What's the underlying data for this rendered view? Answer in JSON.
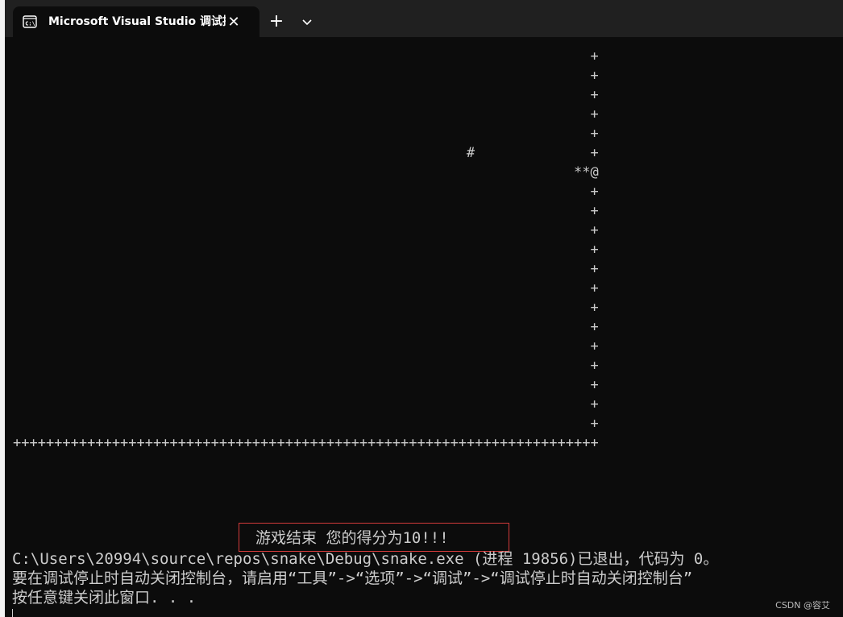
{
  "tab": {
    "title": "Microsoft Visual Studio 调试控制台",
    "icon": "console-icon",
    "close_icon": "close-icon",
    "close_glyph": "✕",
    "new_tab_glyph": "+",
    "new_tab_icon": "plus-icon",
    "dropdown_icon": "chevron-down-icon"
  },
  "console": {
    "game_lines": [
      "                                                                      +",
      "                                                                      +",
      "                                                                      +",
      "                                                                      +",
      "                                                                      +",
      "                                                       #              +",
      "                                                                    **@",
      "                                                                      +",
      "                                                                      +",
      "                                                                      +",
      "                                                                      +",
      "                                                                      +",
      "                                                                      +",
      "                                                                      +",
      "                                                                      +",
      "                                                                      +",
      "                                                                      +",
      "                                                                      +",
      "                                                                      +",
      "                                                                      +",
      "+++++++++++++++++++++++++++++++++++++++++++++++++++++++++++++++++++++++"
    ],
    "game_over": "游戏结束 您的得分为10!!!",
    "exit_lines": [
      "C:\\Users\\20994\\source\\repos\\snake\\Debug\\snake.exe (进程 19856)已退出，代码为 0。",
      "要在调试停止时自动关闭控制台，请启用“工具”->“选项”->“调试”->“调试停止时自动关闭控制台”",
      "按任意键关闭此窗口. . ."
    ]
  },
  "watermark": "CSDN @容艾",
  "colors": {
    "background": "#0c0c0c",
    "text": "#cccccc",
    "highlight_border": "#d33a3a",
    "titlebar": "#202020"
  }
}
